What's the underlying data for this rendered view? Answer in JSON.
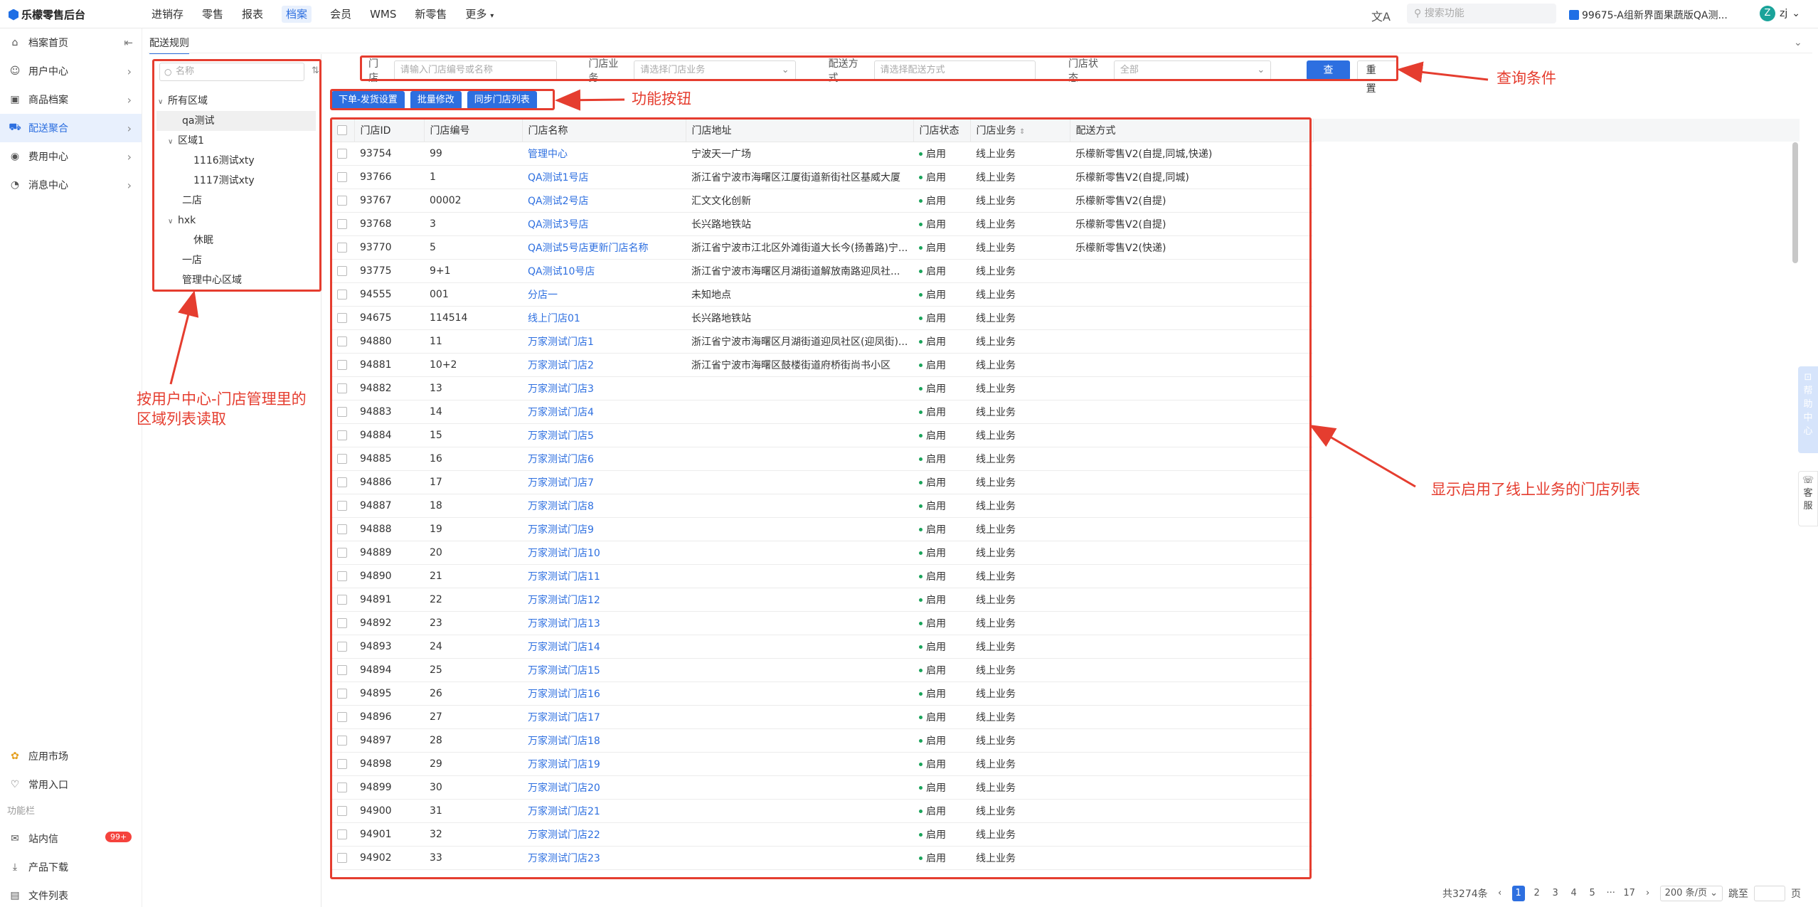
{
  "app": {
    "title": "乐檬零售后台"
  },
  "topnav": {
    "menus": [
      {
        "label": "进销存"
      },
      {
        "label": "零售"
      },
      {
        "label": "报表"
      },
      {
        "label": "档案"
      },
      {
        "label": "会员"
      },
      {
        "label": "WMS"
      },
      {
        "label": "新零售"
      },
      {
        "label": "更多"
      }
    ],
    "search_placeholder": "搜索功能",
    "project": "99675-A组新界面果蔬版QA测...",
    "user": "zj",
    "avatar_letter": "Z"
  },
  "sidebar": {
    "items": [
      {
        "label": "档案首页"
      },
      {
        "label": "用户中心"
      },
      {
        "label": "商品档案"
      },
      {
        "label": "配送聚合"
      },
      {
        "label": "费用中心"
      },
      {
        "label": "消息中心"
      }
    ],
    "bottom": {
      "app_market": "应用市场",
      "common_entry": "常用入口",
      "group_label": "功能栏",
      "inbox": "站内信",
      "inbox_badge": "99+",
      "download": "产品下载",
      "files": "文件列表"
    }
  },
  "tab": {
    "label": "配送规则"
  },
  "tree": {
    "search_placeholder": "名称",
    "nodes": [
      "所有区域",
      "qa测试",
      "区域1",
      "1116测试xty",
      "1117测试xty",
      "二店",
      "hxk",
      "休眠",
      "一店",
      "管理中心区域"
    ]
  },
  "filters": {
    "store_label": "门店",
    "store_placeholder": "请输入门店编号或名称",
    "business_label": "门店业务",
    "business_placeholder": "请选择门店业务",
    "delivery_label": "配送方式",
    "delivery_placeholder": "请选择配送方式",
    "status_label": "门店状态",
    "status_value": "全部",
    "query_btn": "查 询",
    "reset_btn": "重 置"
  },
  "actions": {
    "order_ship": "下单-发货设置",
    "batch_edit": "批量修改",
    "sync_list": "同步门店列表"
  },
  "table": {
    "columns": [
      "门店ID",
      "门店编号",
      "门店名称",
      "门店地址",
      "门店状态",
      "门店业务",
      "配送方式"
    ],
    "rows": [
      [
        "93754",
        "99",
        "管理中心",
        "宁波天一广场",
        "启用",
        "线上业务",
        "乐檬新零售V2(自提,同城,快递)"
      ],
      [
        "93766",
        "1",
        "QA测试1号店",
        "浙江省宁波市海曙区江厦街道新街社区基威大厦",
        "启用",
        "线上业务",
        "乐檬新零售V2(自提,同城)"
      ],
      [
        "93767",
        "00002",
        "QA测试2号店",
        "汇文文化创新",
        "启用",
        "线上业务",
        "乐檬新零售V2(自提)"
      ],
      [
        "93768",
        "3",
        "QA测试3号店",
        "长兴路地铁站",
        "启用",
        "线上业务",
        "乐檬新零售V2(自提)"
      ],
      [
        "93770",
        "5",
        "QA测试5号店更新门店名称",
        "浙江省宁波市江北区外滩街道大长今(扬善路)宁...",
        "启用",
        "线上业务",
        "乐檬新零售V2(快递)"
      ],
      [
        "93775",
        "9+1",
        "QA测试10号店",
        "浙江省宁波市海曙区月湖街道解放南路迎凤社...",
        "启用",
        "线上业务",
        ""
      ],
      [
        "94555",
        "001",
        "分店一",
        "未知地点",
        "启用",
        "线上业务",
        ""
      ],
      [
        "94675",
        "114514",
        "线上门店01",
        "长兴路地铁站",
        "启用",
        "线上业务",
        ""
      ],
      [
        "94880",
        "11",
        "万家测试门店1",
        "浙江省宁波市海曙区月湖街道迎凤社区(迎凤街)...",
        "启用",
        "线上业务",
        ""
      ],
      [
        "94881",
        "10+2",
        "万家测试门店2",
        "浙江省宁波市海曙区鼓楼街道府桥街尚书小区",
        "启用",
        "线上业务",
        ""
      ],
      [
        "94882",
        "13",
        "万家测试门店3",
        "",
        "启用",
        "线上业务",
        ""
      ],
      [
        "94883",
        "14",
        "万家测试门店4",
        "",
        "启用",
        "线上业务",
        ""
      ],
      [
        "94884",
        "15",
        "万家测试门店5",
        "",
        "启用",
        "线上业务",
        ""
      ],
      [
        "94885",
        "16",
        "万家测试门店6",
        "",
        "启用",
        "线上业务",
        ""
      ],
      [
        "94886",
        "17",
        "万家测试门店7",
        "",
        "启用",
        "线上业务",
        ""
      ],
      [
        "94887",
        "18",
        "万家测试门店8",
        "",
        "启用",
        "线上业务",
        ""
      ],
      [
        "94888",
        "19",
        "万家测试门店9",
        "",
        "启用",
        "线上业务",
        ""
      ],
      [
        "94889",
        "20",
        "万家测试门店10",
        "",
        "启用",
        "线上业务",
        ""
      ],
      [
        "94890",
        "21",
        "万家测试门店11",
        "",
        "启用",
        "线上业务",
        ""
      ],
      [
        "94891",
        "22",
        "万家测试门店12",
        "",
        "启用",
        "线上业务",
        ""
      ],
      [
        "94892",
        "23",
        "万家测试门店13",
        "",
        "启用",
        "线上业务",
        ""
      ],
      [
        "94893",
        "24",
        "万家测试门店14",
        "",
        "启用",
        "线上业务",
        ""
      ],
      [
        "94894",
        "25",
        "万家测试门店15",
        "",
        "启用",
        "线上业务",
        ""
      ],
      [
        "94895",
        "26",
        "万家测试门店16",
        "",
        "启用",
        "线上业务",
        ""
      ],
      [
        "94896",
        "27",
        "万家测试门店17",
        "",
        "启用",
        "线上业务",
        ""
      ],
      [
        "94897",
        "28",
        "万家测试门店18",
        "",
        "启用",
        "线上业务",
        ""
      ],
      [
        "94898",
        "29",
        "万家测试门店19",
        "",
        "启用",
        "线上业务",
        ""
      ],
      [
        "94899",
        "30",
        "万家测试门店20",
        "",
        "启用",
        "线上业务",
        ""
      ],
      [
        "94900",
        "31",
        "万家测试门店21",
        "",
        "启用",
        "线上业务",
        ""
      ],
      [
        "94901",
        "32",
        "万家测试门店22",
        "",
        "启用",
        "线上业务",
        ""
      ],
      [
        "94902",
        "33",
        "万家测试门店23",
        "",
        "启用",
        "线上业务",
        ""
      ]
    ]
  },
  "pagination": {
    "total": "共3274条",
    "pages": [
      "1",
      "2",
      "3",
      "4",
      "5",
      "···",
      "17"
    ],
    "page_size": "200 条/页",
    "jump_label": "跳至",
    "page_unit": "页"
  },
  "float": {
    "help": [
      "帮",
      "助",
      "中",
      "心"
    ],
    "service": [
      "客",
      "服"
    ]
  },
  "annotations": {
    "query": "查询条件",
    "actions": "功能按钮",
    "tree_line1": "按用户中心-门店管理里的",
    "tree_line2": "区域列表读取",
    "table": "显示启用了线上业务的门店列表"
  },
  "colors": {
    "accent": "#2d6fe0",
    "annotation": "#e53d2f",
    "status_ok": "#1aa35a"
  }
}
